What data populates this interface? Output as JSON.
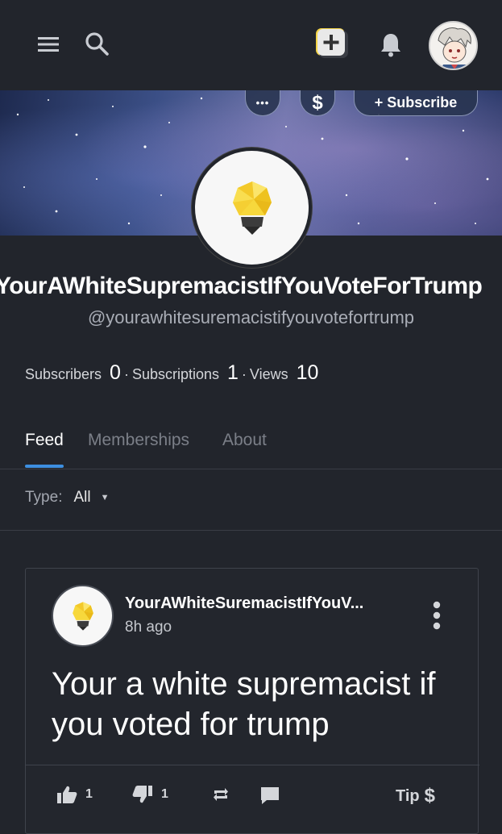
{
  "header": {
    "icons": [
      "menu-icon",
      "search-icon",
      "add-post-icon",
      "bell-icon"
    ],
    "user_avatar": "user-avatar"
  },
  "banner": {
    "more_label": "•••",
    "tip_label": "$",
    "subscribe_label": "+ Subscribe"
  },
  "channel": {
    "name": "YourAWhiteSupremacistIfYouVoteForTrump",
    "handle": "@yourawhitesuremacistifyouvotefortrump",
    "stats": {
      "subscribers_label": "Subscribers",
      "subscribers": "0",
      "subscriptions_label": "Subscriptions",
      "subscriptions": "1",
      "views_label": "Views",
      "views": "10"
    }
  },
  "tabs": [
    {
      "label": "Feed",
      "active": true
    },
    {
      "label": "Memberships",
      "active": false
    },
    {
      "label": "About",
      "active": false
    }
  ],
  "filter": {
    "label": "Type:",
    "value": "All"
  },
  "post": {
    "author": "YourAWhiteSuremacistIfYouV...",
    "time": "8h ago",
    "text": "Your a white supremacist if you voted for trump",
    "likes": "1",
    "dislikes": "1",
    "tip_label": "Tip"
  },
  "colors": {
    "background": "#22252c",
    "accent": "#3d8fe0",
    "text": "#ffffff",
    "muted": "#7b7f88",
    "add_button": "#f5d547"
  }
}
